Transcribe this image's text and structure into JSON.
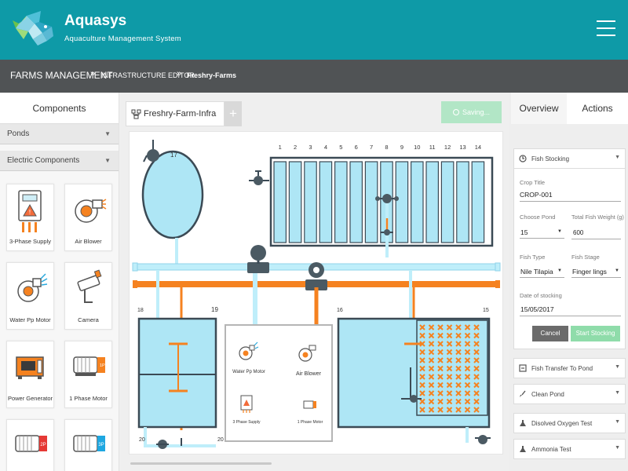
{
  "header": {
    "brand": "Aquasys",
    "tagline": "Aquaculture Management System"
  },
  "breadcrumb": {
    "items": [
      "FARMS MANAGEMENT",
      "INFRASTRUCTURE EDITOR",
      "Freshry-Farms"
    ],
    "separator": "»"
  },
  "components_panel": {
    "title": "Components",
    "sections": [
      "Ponds",
      "Electric Components"
    ],
    "items": [
      {
        "label": "3-Phase Supply",
        "icon": "three-phase-supply-icon"
      },
      {
        "label": "Air Blower",
        "icon": "air-blower-icon"
      },
      {
        "label": "Water Pp Motor",
        "icon": "water-pump-motor-icon"
      },
      {
        "label": "Camera",
        "icon": "camera-icon"
      },
      {
        "label": "Power Generator",
        "icon": "power-generator-icon"
      },
      {
        "label": "1 Phase Motor",
        "icon": "single-phase-motor-icon"
      },
      {
        "label": "",
        "icon": "two-phase-motor-icon",
        "badge": "2P"
      },
      {
        "label": "",
        "icon": "three-phase-motor-icon",
        "badge": "3P"
      }
    ],
    "motor_badge_1p": "1P"
  },
  "editor": {
    "tab_label": "Freshry-Farm-Infra",
    "add_tab": "+",
    "saving_label": "Saving...",
    "raceway_numbers": [
      "1",
      "2",
      "3",
      "4",
      "5",
      "6",
      "7",
      "8",
      "9",
      "10",
      "11",
      "12",
      "13",
      "14"
    ],
    "pond_numbers": {
      "tank": "17",
      "p18": "18",
      "p19": "19",
      "p16": "16",
      "p15": "15",
      "v20a": "20",
      "v20b": "20"
    },
    "room_labels": {
      "water_pump": "Water Pp Motor",
      "air_blower": "Air Blower",
      "supply": "3 Phase Supply",
      "motor": "1 Phase Motor"
    },
    "colors": {
      "water": "#aee6f5",
      "pipe_water": "#bfeefa",
      "pipe_orange": "#f58220",
      "outline": "#3b4a55",
      "valve": "#4b5a63"
    }
  },
  "actions_panel": {
    "tabs": [
      "Overview",
      "Actions"
    ],
    "active_tab": "Actions",
    "fish_stocking": {
      "title": "Fish Stocking",
      "crop_title_label": "Crop Title",
      "crop_title_value": "CROP-001",
      "pond_label": "Choose Pond",
      "pond_value": "15",
      "weight_label": "Total Fish Weight (g)",
      "weight_value": "600",
      "fish_type_label": "Fish Type",
      "fish_type_value": "Nile Tilapia",
      "fish_stage_label": "Fish Stage",
      "fish_stage_value": "Finger lings",
      "date_label": "Date of stocking",
      "date_value": "15/05/2017",
      "cancel_label": "Cancel",
      "start_label": "Start Stocking"
    },
    "other_actions": [
      "Fish Transfer To Pond",
      "Clean Pond",
      "Disolved Oxygen Test",
      "Ammonia Test"
    ]
  },
  "colors": {
    "header": "#0e9aa7",
    "breadcrumb": "#505355",
    "accent_green": "#8fdcaa",
    "cancel_gray": "#6b6b6b"
  }
}
